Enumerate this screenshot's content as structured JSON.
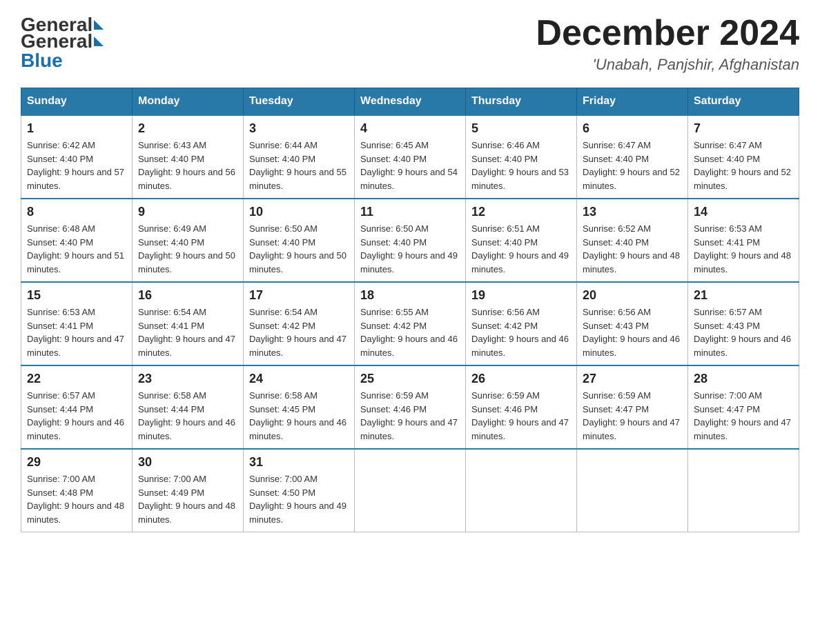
{
  "header": {
    "logo_general": "General",
    "logo_blue": "Blue",
    "month_title": "December 2024",
    "location": "'Unabah, Panjshir, Afghanistan"
  },
  "weekdays": [
    "Sunday",
    "Monday",
    "Tuesday",
    "Wednesday",
    "Thursday",
    "Friday",
    "Saturday"
  ],
  "weeks": [
    [
      {
        "day": "1",
        "sunrise": "6:42 AM",
        "sunset": "4:40 PM",
        "daylight": "9 hours and 57 minutes."
      },
      {
        "day": "2",
        "sunrise": "6:43 AM",
        "sunset": "4:40 PM",
        "daylight": "9 hours and 56 minutes."
      },
      {
        "day": "3",
        "sunrise": "6:44 AM",
        "sunset": "4:40 PM",
        "daylight": "9 hours and 55 minutes."
      },
      {
        "day": "4",
        "sunrise": "6:45 AM",
        "sunset": "4:40 PM",
        "daylight": "9 hours and 54 minutes."
      },
      {
        "day": "5",
        "sunrise": "6:46 AM",
        "sunset": "4:40 PM",
        "daylight": "9 hours and 53 minutes."
      },
      {
        "day": "6",
        "sunrise": "6:47 AM",
        "sunset": "4:40 PM",
        "daylight": "9 hours and 52 minutes."
      },
      {
        "day": "7",
        "sunrise": "6:47 AM",
        "sunset": "4:40 PM",
        "daylight": "9 hours and 52 minutes."
      }
    ],
    [
      {
        "day": "8",
        "sunrise": "6:48 AM",
        "sunset": "4:40 PM",
        "daylight": "9 hours and 51 minutes."
      },
      {
        "day": "9",
        "sunrise": "6:49 AM",
        "sunset": "4:40 PM",
        "daylight": "9 hours and 50 minutes."
      },
      {
        "day": "10",
        "sunrise": "6:50 AM",
        "sunset": "4:40 PM",
        "daylight": "9 hours and 50 minutes."
      },
      {
        "day": "11",
        "sunrise": "6:50 AM",
        "sunset": "4:40 PM",
        "daylight": "9 hours and 49 minutes."
      },
      {
        "day": "12",
        "sunrise": "6:51 AM",
        "sunset": "4:40 PM",
        "daylight": "9 hours and 49 minutes."
      },
      {
        "day": "13",
        "sunrise": "6:52 AM",
        "sunset": "4:40 PM",
        "daylight": "9 hours and 48 minutes."
      },
      {
        "day": "14",
        "sunrise": "6:53 AM",
        "sunset": "4:41 PM",
        "daylight": "9 hours and 48 minutes."
      }
    ],
    [
      {
        "day": "15",
        "sunrise": "6:53 AM",
        "sunset": "4:41 PM",
        "daylight": "9 hours and 47 minutes."
      },
      {
        "day": "16",
        "sunrise": "6:54 AM",
        "sunset": "4:41 PM",
        "daylight": "9 hours and 47 minutes."
      },
      {
        "day": "17",
        "sunrise": "6:54 AM",
        "sunset": "4:42 PM",
        "daylight": "9 hours and 47 minutes."
      },
      {
        "day": "18",
        "sunrise": "6:55 AM",
        "sunset": "4:42 PM",
        "daylight": "9 hours and 46 minutes."
      },
      {
        "day": "19",
        "sunrise": "6:56 AM",
        "sunset": "4:42 PM",
        "daylight": "9 hours and 46 minutes."
      },
      {
        "day": "20",
        "sunrise": "6:56 AM",
        "sunset": "4:43 PM",
        "daylight": "9 hours and 46 minutes."
      },
      {
        "day": "21",
        "sunrise": "6:57 AM",
        "sunset": "4:43 PM",
        "daylight": "9 hours and 46 minutes."
      }
    ],
    [
      {
        "day": "22",
        "sunrise": "6:57 AM",
        "sunset": "4:44 PM",
        "daylight": "9 hours and 46 minutes."
      },
      {
        "day": "23",
        "sunrise": "6:58 AM",
        "sunset": "4:44 PM",
        "daylight": "9 hours and 46 minutes."
      },
      {
        "day": "24",
        "sunrise": "6:58 AM",
        "sunset": "4:45 PM",
        "daylight": "9 hours and 46 minutes."
      },
      {
        "day": "25",
        "sunrise": "6:59 AM",
        "sunset": "4:46 PM",
        "daylight": "9 hours and 47 minutes."
      },
      {
        "day": "26",
        "sunrise": "6:59 AM",
        "sunset": "4:46 PM",
        "daylight": "9 hours and 47 minutes."
      },
      {
        "day": "27",
        "sunrise": "6:59 AM",
        "sunset": "4:47 PM",
        "daylight": "9 hours and 47 minutes."
      },
      {
        "day": "28",
        "sunrise": "7:00 AM",
        "sunset": "4:47 PM",
        "daylight": "9 hours and 47 minutes."
      }
    ],
    [
      {
        "day": "29",
        "sunrise": "7:00 AM",
        "sunset": "4:48 PM",
        "daylight": "9 hours and 48 minutes."
      },
      {
        "day": "30",
        "sunrise": "7:00 AM",
        "sunset": "4:49 PM",
        "daylight": "9 hours and 48 minutes."
      },
      {
        "day": "31",
        "sunrise": "7:00 AM",
        "sunset": "4:50 PM",
        "daylight": "9 hours and 49 minutes."
      },
      null,
      null,
      null,
      null
    ]
  ],
  "labels": {
    "sunrise": "Sunrise:",
    "sunset": "Sunset:",
    "daylight": "Daylight:"
  }
}
